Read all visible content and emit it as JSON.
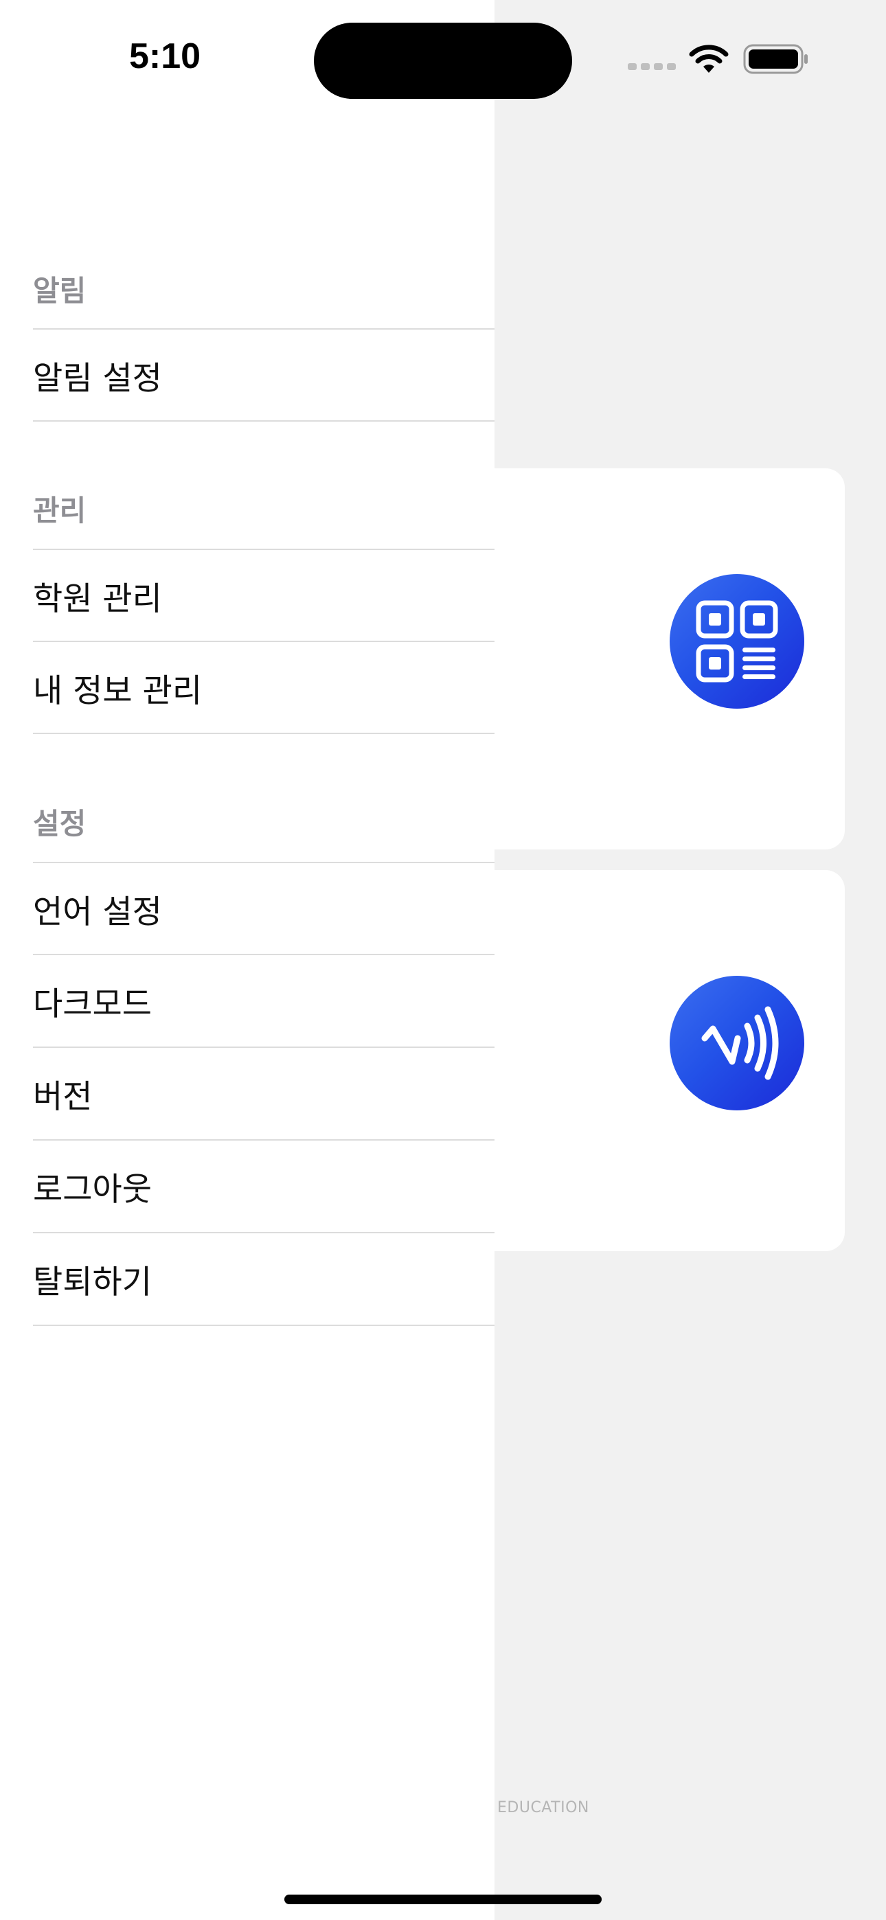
{
  "status_bar": {
    "time": "5:10"
  },
  "drawer": {
    "sections": [
      {
        "header": "알림",
        "items": [
          "알림 설정"
        ]
      },
      {
        "header": "관리",
        "items": [
          "학원 관리",
          "내 정보 관리"
        ]
      },
      {
        "header": "설정",
        "items": [
          "언어 설정",
          "다크모드",
          "버전",
          "로그아웃",
          "탈퇴하기"
        ]
      }
    ]
  },
  "background": {
    "cards": [
      {
        "icon": "qr-code-icon"
      },
      {
        "icon": "nfc-icon"
      }
    ],
    "footer_brand": "EDUCATION"
  },
  "colors": {
    "accent_blue": "#2352e8",
    "section_header": "#8e8e93",
    "divider": "#dcdcdc",
    "background": "#f1f1f1"
  }
}
